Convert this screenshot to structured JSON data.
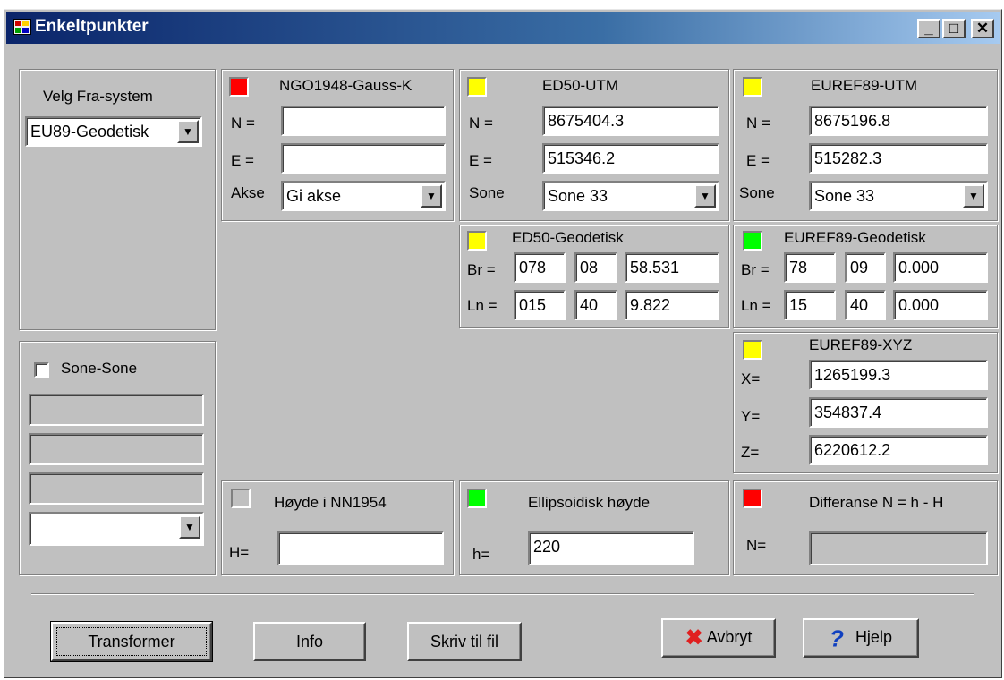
{
  "window": {
    "title": "Enkeltpunkter",
    "controls": [
      "_",
      "□",
      "✕"
    ]
  },
  "source": {
    "label": "Velg Fra-system",
    "selected": "EU89-Geodetisk"
  },
  "zone": {
    "checkbox_label": "Sone-Sone",
    "select_value": ""
  },
  "ngo": {
    "title": "NGO1948-Gauss-K",
    "status_color": "#ff0000",
    "n_label": "N =",
    "n_value": "",
    "e_label": "E =",
    "e_value": "",
    "akse_label": "Akse",
    "akse_value": "Gi akse"
  },
  "ed50utm": {
    "title": "ED50-UTM",
    "status_color": "#ffff00",
    "n_label": "N =",
    "n_value": "8675404.3",
    "e_label": "E =",
    "e_value": "515346.2",
    "sone_label": "Sone",
    "sone_value": "Sone 33"
  },
  "euref_utm": {
    "title": "EUREF89-UTM",
    "status_color": "#ffff00",
    "n_label": "N =",
    "n_value": "8675196.8",
    "e_label": "E =",
    "e_value": "515282.3",
    "sone_label": "Sone",
    "sone_value": "Sone 33"
  },
  "ed50geo": {
    "title": "ED50-Geodetisk",
    "status_color": "#ffff00",
    "br_label": "Br =",
    "br": [
      "078",
      "08",
      "58.531"
    ],
    "ln_label": "Ln =",
    "ln": [
      "015",
      "40",
      "9.822"
    ]
  },
  "euref_geo": {
    "title": "EUREF89-Geodetisk",
    "status_color": "#00ff00",
    "br_label": "Br =",
    "br": [
      "78",
      "09",
      "0.000"
    ],
    "ln_label": "Ln =",
    "ln": [
      "15",
      "40",
      "0.000"
    ]
  },
  "euref_xyz": {
    "title": "EUREF89-XYZ",
    "status_color": "#ffff00",
    "x_label": "X=",
    "x_value": "1265199.3",
    "y_label": "Y=",
    "y_value": "354837.4",
    "z_label": "Z=",
    "z_value": "6220612.2"
  },
  "height_nn": {
    "title": "Høyde i NN1954",
    "status_color": "#c0c0c0",
    "h_label": "H=",
    "h_value": ""
  },
  "ellip": {
    "title": "Ellipsoidisk høyde",
    "status_color": "#00ff00",
    "h_label": "h=",
    "h_value": "220"
  },
  "diff": {
    "title": "Differanse N = h - H",
    "status_color": "#ff0000",
    "n_label": "N=",
    "n_value": ""
  },
  "buttons": {
    "transform": "Transformer",
    "info": "Info",
    "write": "Skriv til fil",
    "cancel": "Avbryt",
    "help": "Hjelp"
  }
}
